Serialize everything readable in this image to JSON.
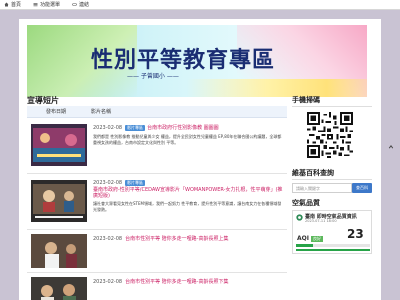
{
  "nav": {
    "items": [
      {
        "label": "首頁",
        "icon": "home-icon"
      },
      {
        "label": "功能選單",
        "icon": "menu-icon"
      },
      {
        "label": "連結",
        "icon": "link-icon"
      }
    ]
  },
  "banner": {
    "title": "性別平等教育專區",
    "subtitle": "—— 子曾國小 ——"
  },
  "videos": {
    "section_title": "宣導短片",
    "col_date": "發布日期",
    "col_title": "影片名稱",
    "rows": [
      {
        "date": "2023-02-08",
        "tag": "影片專區",
        "title": "台南市政府行性別影像教 圖圖圖",
        "desc": "我們都是 性別影像教 推動兒童與少女 權益，提升全民對女性兒童權益 EP,80年在聯合國公約議題，全球都重視女孩的權益，台南市設定文化與性別 平等。"
      },
      {
        "date": "2023-02-08",
        "tag": "影片專區",
        "title": "臺南市政府-性別平等/CEDAW宣導影片「WOMANPOWER-女力扎根，性平萌芽」(推廣短版)",
        "desc": "讓社會大眾看見女性在STEM領域，我們一起努力 性平教育，提升性別平等意識，讓台南女力在各種領域發光發熱。"
      },
      {
        "date": "2023-02-08",
        "tag": "",
        "title": "台南市性別平等 陪你多走一哩路-高齡長照上集",
        "desc": ""
      },
      {
        "date": "2023-02-08",
        "tag": "",
        "title": "台南市性別平等 陪你多走一哩路-高齡長照下集",
        "desc": ""
      }
    ]
  },
  "sidebar": {
    "mobile_title": "手機掃碼",
    "wiki_title": "維基百科查詢",
    "search_placeholder": "請輸入關鍵字",
    "search_button": "查百科",
    "air_title": "空氣品質",
    "aqi": {
      "city": "臺南 即時空氣品質資訊",
      "time": "2023-07-11 18:00",
      "label": "AQI",
      "status": "良好",
      "value": "23",
      "level_fraction": 0.23
    }
  }
}
